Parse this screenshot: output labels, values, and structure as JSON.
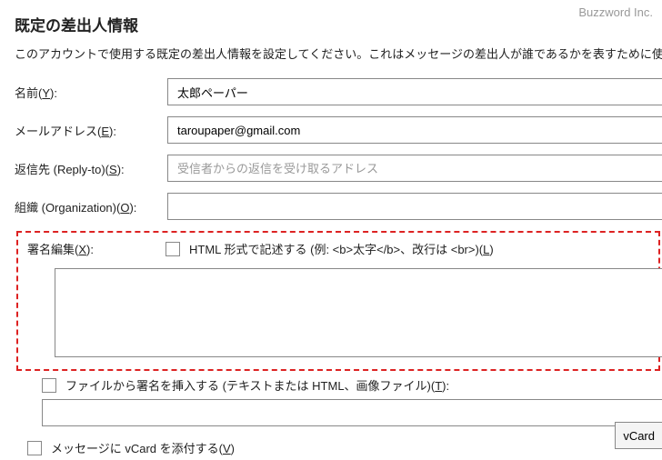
{
  "brand": "Buzzword Inc.",
  "heading": "既定の差出人情報",
  "description": "このアカウントで使用する既定の差出人情報を設定してください。これはメッセージの差出人が誰であるかを表すために使用さ",
  "fields": {
    "name": {
      "label_pre": "名前(",
      "key": "Y",
      "label_post": "):",
      "value": "太郎ペーパー"
    },
    "email": {
      "label_pre": "メールアドレス(",
      "key": "E",
      "label_post": "):",
      "value": "taroupaper@gmail.com"
    },
    "replyto": {
      "label_pre": "返信先 (Reply-to)(",
      "key": "S",
      "label_post": "):",
      "placeholder": "受信者からの返信を受け取るアドレス"
    },
    "org": {
      "label_pre": "組織 (Organization)(",
      "key": "O",
      "label_post": "):"
    }
  },
  "signature": {
    "label_pre": "署名編集(",
    "key": "X",
    "label_post": "):",
    "html_checkbox_pre": "HTML 形式で記述する (例: <b>太字</b>、改行は <br>)(",
    "html_checkbox_key": "L",
    "html_checkbox_post": ")"
  },
  "file_sig": {
    "pre": "ファイルから署名を挿入する (テキストまたは HTML、画像ファイル)(",
    "key": "T",
    "post": "):"
  },
  "vcard": {
    "pre": "メッセージに vCard を添付する(",
    "key": "V",
    "post": ")",
    "button": "vCard"
  }
}
